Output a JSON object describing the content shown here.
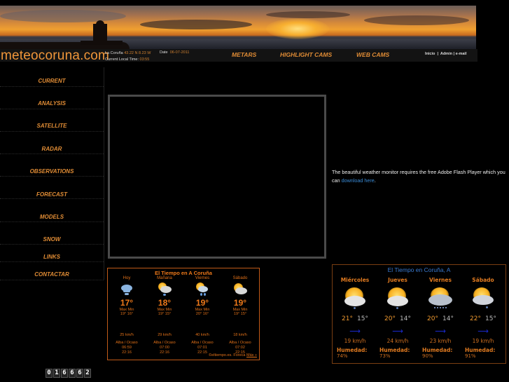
{
  "site": {
    "logo": "meteocoruna.com",
    "location_label": "La Coruña",
    "coords": "43.22 N 8.23 W",
    "date_label": "Date",
    "date_value": "06-07-2011",
    "local_time_label": "Current Local Time:",
    "local_time_value": "03:55"
  },
  "top_nav": [
    {
      "label": "METARS"
    },
    {
      "label": "HIGHLIGHT CAMS"
    },
    {
      "label": "WEB CAMS"
    }
  ],
  "top_links": {
    "inicio": "Inicio",
    "sep1": "|",
    "admin": "Admin",
    "sep2": "|",
    "email": "e-mail"
  },
  "sidebar": [
    {
      "label": "CURRENT"
    },
    {
      "label": "ANALYSIS"
    },
    {
      "label": "SATELLITE"
    },
    {
      "label": "RADAR"
    },
    {
      "label": "OBSERVATIONS"
    },
    {
      "label": "FORECAST"
    },
    {
      "label": "MODELS"
    },
    {
      "label": "SNOW"
    },
    {
      "label": "LINKS"
    },
    {
      "label": "CONTACTAR"
    }
  ],
  "flash": {
    "message": "The beautiful weather monitor requires the free Adobe Flash Player which you can ",
    "link": "download here",
    "end": "."
  },
  "widget1": {
    "title": "El Tiempo en A Coruña",
    "max_label": "Max",
    "min_label": "Min",
    "sun_label": "Alba / Ocaso",
    "days": [
      {
        "day": "Hoy",
        "icon": "fog-cloud-icon",
        "temp": "17°",
        "max": "19°",
        "min": "16°",
        "wind": "25 km/h",
        "sunrise": "06:59",
        "sunset": "22:16"
      },
      {
        "day": "Mañana",
        "icon": "sun-cloud-rain-icon",
        "temp": "18°",
        "max": "19°",
        "min": "15°",
        "wind": "29 km/h",
        "sunrise": "07:00",
        "sunset": "22:16"
      },
      {
        "day": "Viernes",
        "icon": "sun-cloud-rain-icon",
        "temp": "19°",
        "max": "20°",
        "min": "16°",
        "wind": "40 km/h",
        "sunrise": "07:01",
        "sunset": "22:15"
      },
      {
        "day": "Sábado",
        "icon": "sun-cloud-icon",
        "temp": "19°",
        "max": "19°",
        "min": "15°",
        "wind": "18 km/h",
        "sunrise": "07:02",
        "sunset": "22:15"
      }
    ],
    "footer_text": "©eltiempo.es. Foreca ",
    "footer_link": "Más »"
  },
  "widget2": {
    "title": "El Tiempo en Coruña, A",
    "humidity_label": "Humedad:",
    "days": [
      {
        "day": "Miércoles",
        "icon": "sun-cloud-drizzle-icon",
        "max": "21°",
        "min": "15°",
        "wind": "19 km/h",
        "humidity": "74%"
      },
      {
        "day": "Jueves",
        "icon": "sun-cloud-drizzle-icon",
        "max": "20°",
        "min": "14°",
        "wind": "24 km/h",
        "humidity": "73%"
      },
      {
        "day": "Viernes",
        "icon": "sun-cloud-rain-icon",
        "max": "20°",
        "min": "14°",
        "wind": "23 km/h",
        "humidity": "90%"
      },
      {
        "day": "Sábado",
        "icon": "sun-cloud-drizzle-icon",
        "max": "22°",
        "min": "15°",
        "wind": "19 km/h",
        "humidity": "91%"
      }
    ],
    "wind_arrow": "⟶"
  },
  "counter": {
    "digits": [
      "0",
      "1",
      "6",
      "6",
      "6",
      "2"
    ]
  }
}
